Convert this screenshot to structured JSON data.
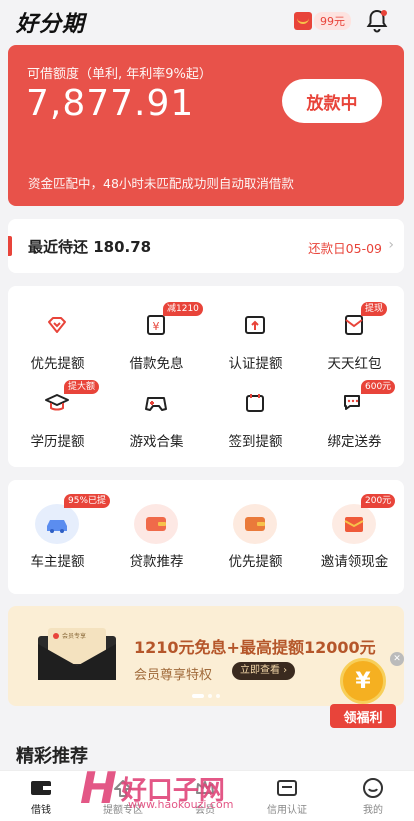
{
  "app": {
    "logo": "好分期"
  },
  "top": {
    "red_packet_amount": "99元"
  },
  "credit": {
    "label": "可借额度（单利, 年利率9%起）",
    "amount": "7,877.91",
    "button": "放款中",
    "note": "资金匹配中，48小时未匹配成功则自动取消借款"
  },
  "repay": {
    "title": "最近待还 180.78",
    "due": "还款日05-09"
  },
  "grid1": [
    {
      "label": "优先提额",
      "icon": "diamond-icon",
      "badge": ""
    },
    {
      "label": "借款免息",
      "icon": "yen-doc-icon",
      "badge": "减1210"
    },
    {
      "label": "认证提额",
      "icon": "upload-box-icon",
      "badge": ""
    },
    {
      "label": "天天红包",
      "icon": "envelope-icon",
      "badge": "提现"
    },
    {
      "label": "学历提额",
      "icon": "graduation-cap-icon",
      "badge": "提大额"
    },
    {
      "label": "游戏合集",
      "icon": "gamepad-icon",
      "badge": ""
    },
    {
      "label": "签到提额",
      "icon": "calendar-icon",
      "badge": ""
    },
    {
      "label": "绑定送券",
      "icon": "chat-bubbles-icon",
      "badge": "600元"
    }
  ],
  "grid2": [
    {
      "label": "车主提额",
      "icon": "car-icon",
      "badge": "95%已提"
    },
    {
      "label": "贷款推荐",
      "icon": "wallet-icon",
      "badge": ""
    },
    {
      "label": "优先提额",
      "icon": "wallet-icon",
      "badge": ""
    },
    {
      "label": "邀请领现金",
      "icon": "red-envelope-icon",
      "badge": "200元"
    }
  ],
  "banner": {
    "envelope_text": "会员专享",
    "headline": "1210元免息+最高提额12000元",
    "sub": "会员尊享特权",
    "cta": "立即查看 ›"
  },
  "welfare": {
    "label": "领福利",
    "coin": "¥"
  },
  "section": {
    "title": "精彩推荐"
  },
  "tabs": [
    {
      "label": "借钱",
      "icon": "wallet-tab-icon"
    },
    {
      "label": "提额专区",
      "icon": "upgrade-icon"
    },
    {
      "label": "会员",
      "icon": "crown-icon"
    },
    {
      "label": "信用认证",
      "icon": "card-icon"
    },
    {
      "label": "我的",
      "icon": "smile-icon"
    }
  ],
  "watermark": {
    "text": "好口子网",
    "url": "www.haokouzi.com"
  },
  "colors": {
    "accent": "#e8443a",
    "card": "#e8524a",
    "background": "#f3f3f5"
  }
}
